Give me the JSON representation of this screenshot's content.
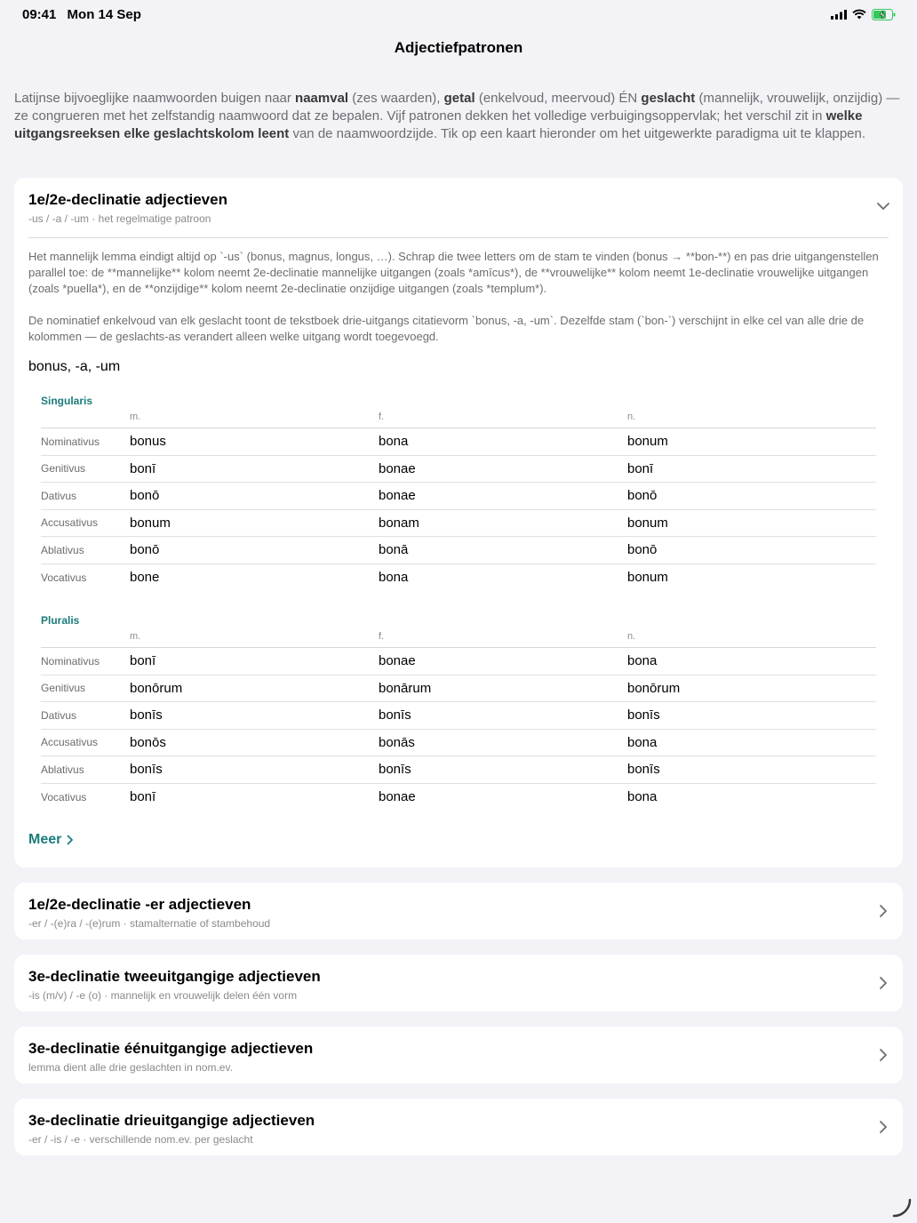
{
  "status": {
    "time": "09:41",
    "date": "Mon 14 Sep"
  },
  "nav": {
    "title": "Adjectiefpatronen"
  },
  "intro": {
    "p1": "Latijnse bijvoeglijke naamwoorden buigen naar ",
    "b1": "naamval",
    "p2": " (zes waarden), ",
    "b2": "getal",
    "p3": " (enkelvoud, meervoud) ÉN ",
    "b3": "geslacht",
    "p4": " (mannelijk, vrouwelijk, onzijdig) — ze congrueren met het zelfstandig naamwoord dat ze bepalen. Vijf patronen dekken het volledige verbuigingsoppervlak; het verschil zit in ",
    "b4": "welke uitgangsreeksen elke geslachtskolom leent",
    "p5": " van de naamwoordzijde. Tik op een kaart hieronder om het uitgewerkte paradigma uit te klappen."
  },
  "expanded": {
    "title": "1e/2e-declinatie adjectieven",
    "subtitle": "-us / -a / -um · het regelmatige patroon",
    "desc1": "Het mannelijk lemma eindigt altijd op `-us` (bonus, magnus, longus, …). Schrap die twee letters om de stam te vinden (bonus → **bon-**) en pas drie uitgangenstellen parallel toe: de **mannelijke** kolom neemt 2e-declinatie mannelijke uitgangen (zoals *amīcus*), de **vrouwelijke** kolom neemt 1e-declinatie vrouwelijke uitgangen (zoals *puella*), en de **onzijdige** kolom neemt 2e-declinatie onzijdige uitgangen (zoals *templum*).",
    "desc2": "De nominatief enkelvoud van elk geslacht toont de tekstboek drie-uitgangs citatievorm `bonus, -a, -um`. Dezelfde stam (`bon-`) verschijnt in elke cel van alle drie de kolommen — de geslachts-as verandert alleen welke uitgang wordt toegevoegd.",
    "paradigm": "bonus, -a, -um",
    "columns": [
      "m.",
      "f.",
      "n."
    ],
    "singular": {
      "label": "Singularis",
      "rows": [
        {
          "case": "Nominativus",
          "m": "bonus",
          "f": "bona",
          "n": "bonum"
        },
        {
          "case": "Genitivus",
          "m": "bonī",
          "f": "bonae",
          "n": "bonī"
        },
        {
          "case": "Dativus",
          "m": "bonō",
          "f": "bonae",
          "n": "bonō"
        },
        {
          "case": "Accusativus",
          "m": "bonum",
          "f": "bonam",
          "n": "bonum"
        },
        {
          "case": "Ablativus",
          "m": "bonō",
          "f": "bonā",
          "n": "bonō"
        },
        {
          "case": "Vocativus",
          "m": "bone",
          "f": "bona",
          "n": "bonum"
        }
      ]
    },
    "plural": {
      "label": "Pluralis",
      "rows": [
        {
          "case": "Nominativus",
          "m": "bonī",
          "f": "bonae",
          "n": "bona"
        },
        {
          "case": "Genitivus",
          "m": "bonōrum",
          "f": "bonārum",
          "n": "bonōrum"
        },
        {
          "case": "Dativus",
          "m": "bonīs",
          "f": "bonīs",
          "n": "bonīs"
        },
        {
          "case": "Accusativus",
          "m": "bonōs",
          "f": "bonās",
          "n": "bona"
        },
        {
          "case": "Ablativus",
          "m": "bonīs",
          "f": "bonīs",
          "n": "bonīs"
        },
        {
          "case": "Vocativus",
          "m": "bonī",
          "f": "bonae",
          "n": "bona"
        }
      ]
    },
    "more_label": "Meer"
  },
  "cards": [
    {
      "title": "1e/2e-declinatie -er adjectieven",
      "subtitle": "-er / -(e)ra / -(e)rum · stamalternatie of stambehoud"
    },
    {
      "title": "3e-declinatie tweeuitgangige adjectieven",
      "subtitle": "-is (m/v) / -e (o) · mannelijk en vrouwelijk delen één vorm"
    },
    {
      "title": "3e-declinatie éénuitgangige adjectieven",
      "subtitle": "lemma dient alle drie geslachten in nom.ev."
    },
    {
      "title": "3e-declinatie drieuitgangige adjectieven",
      "subtitle": "-er / -is / -e · verschillende nom.ev. per geslacht"
    }
  ],
  "colors": {
    "accent": "#1b7b7b",
    "background": "#f2f2f7"
  }
}
